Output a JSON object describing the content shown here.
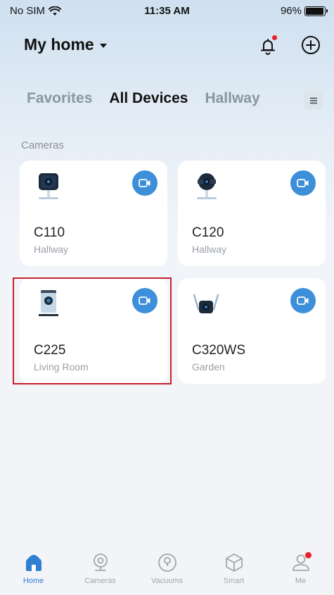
{
  "status_bar": {
    "carrier": "No SIM",
    "time": "11:35 AM",
    "battery": "96%",
    "battery_level": 0.96
  },
  "header": {
    "home_name": "My home"
  },
  "tabs": [
    {
      "label": "Favorites",
      "active": false
    },
    {
      "label": "All Devices",
      "active": true
    },
    {
      "label": "Hallway",
      "active": false
    }
  ],
  "section": {
    "label": "Cameras"
  },
  "devices": [
    {
      "name": "C110",
      "room": "Hallway",
      "icon": "c110-camera-icon"
    },
    {
      "name": "C120",
      "room": "Hallway",
      "icon": "c120-camera-icon"
    },
    {
      "name": "C225",
      "room": "Living Room",
      "icon": "c225-camera-icon"
    },
    {
      "name": "C320WS",
      "room": "Garden",
      "icon": "c320ws-camera-icon"
    }
  ],
  "nav": [
    {
      "label": "Home",
      "icon": "home-icon",
      "active": true
    },
    {
      "label": "Cameras",
      "icon": "camera-icon",
      "active": false
    },
    {
      "label": "Vacuums",
      "icon": "vacuum-icon",
      "active": false
    },
    {
      "label": "Smart",
      "icon": "smart-cube-icon",
      "active": false
    },
    {
      "label": "Me",
      "icon": "person-icon",
      "active": false
    }
  ],
  "colors": {
    "accent": "#3c8fd8",
    "active_nav": "#2f7fd4",
    "notification": "#e8202a",
    "highlight": "#c8202e"
  }
}
